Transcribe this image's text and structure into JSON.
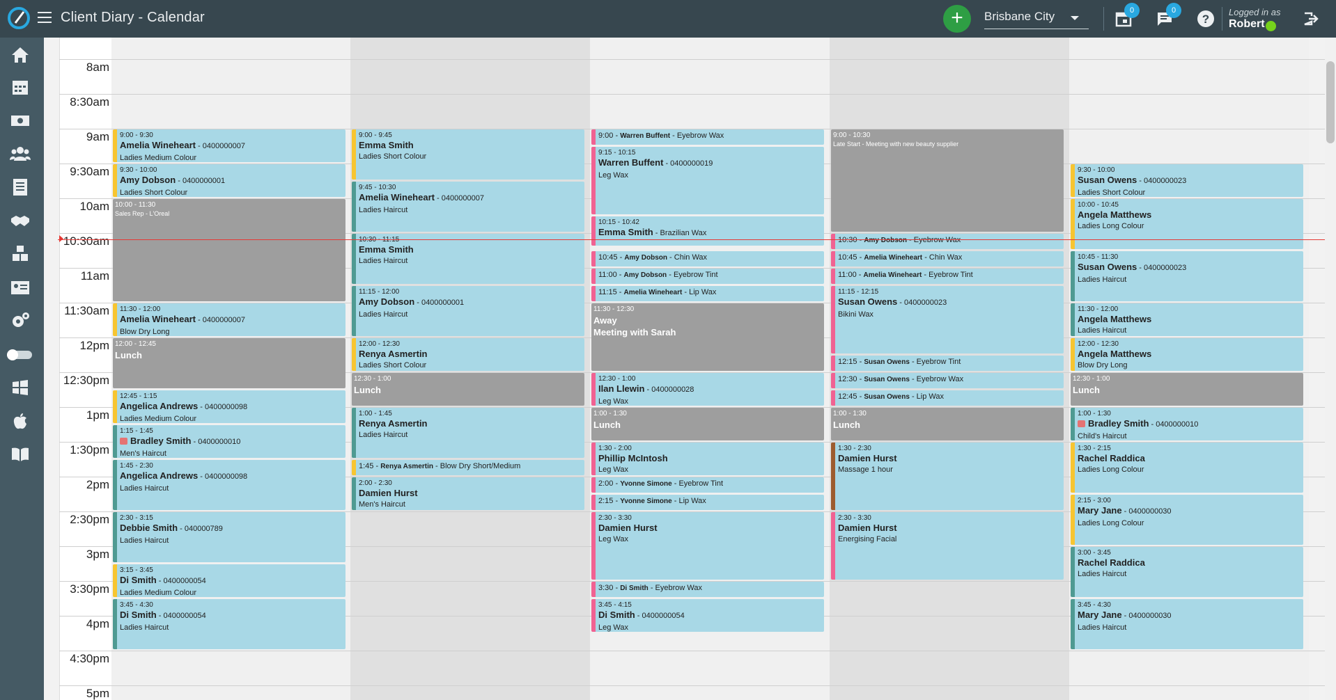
{
  "header": {
    "title": "Client Diary - Calendar",
    "location": "Brisbane City",
    "appointments_badge": "0",
    "messages_badge": "0",
    "logged_in_label": "Logged in as",
    "user": "Robert"
  },
  "sidebar": {
    "items": [
      "home-icon",
      "calendar-icon",
      "cash-icon",
      "clients-icon",
      "notes-icon",
      "handshake-icon",
      "boxes-icon",
      "id-card-icon",
      "settings-icon",
      "toggle-icon",
      "windows-icon",
      "apple-icon",
      "book-icon"
    ]
  },
  "times": [
    "8am",
    "8:30am",
    "9am",
    "9:30am",
    "10am",
    "10:30am",
    "11am",
    "11:30am",
    "12pm",
    "12:30pm",
    "1pm",
    "1:30pm",
    "2pm",
    "2:30pm",
    "3pm",
    "3:30pm",
    "4pm",
    "4:30pm",
    "5pm"
  ],
  "columns": [
    {
      "appointments": [
        {
          "time": "9:00 - 9:30",
          "name": "Amelia Wineheart",
          "phone": " - 0400000007",
          "service": "Ladies Medium Colour",
          "color": "yellow",
          "start": 9.0,
          "end": 9.5
        },
        {
          "time": "9:30 - 10:00",
          "name": "Amy Dobson",
          "phone": " - 0400000001",
          "service": "Ladies Short Colour",
          "color": "yellow",
          "start": 9.5,
          "end": 10.0
        },
        {
          "type": "block",
          "time": "10:00 - 11:30",
          "label": "",
          "sub": "Sales Rep - L'Oreal",
          "start": 10.0,
          "end": 11.5
        },
        {
          "time": "11:30 - 12:00",
          "name": "Amelia Wineheart",
          "phone": " - 0400000007",
          "service": "Blow Dry Long",
          "color": "yellow",
          "start": 11.5,
          "end": 12.0
        },
        {
          "type": "block",
          "time": "12:00 - 12:45",
          "label": "Lunch",
          "sub": "",
          "start": 12.0,
          "end": 12.75
        },
        {
          "time": "12:45 - 1:15",
          "name": "Angelica Andrews",
          "phone": " - 0400000098",
          "service": "Ladies Medium Colour",
          "color": "yellow",
          "start": 12.75,
          "end": 13.25
        },
        {
          "time": "1:15 - 1:45",
          "name": "Bradley Smith",
          "phone": " - 0400000010",
          "service": "Men's Haircut",
          "color": "teal",
          "kid": true,
          "start": 13.25,
          "end": 13.75
        },
        {
          "time": "1:45 - 2:30",
          "name": "Angelica Andrews",
          "phone": " - 0400000098",
          "service": "Ladies Haircut",
          "color": "teal",
          "start": 13.75,
          "end": 14.5
        },
        {
          "time": "2:30 - 3:15",
          "name": "Debbie Smith",
          "phone": " - 040000789",
          "service": "Ladies Haircut",
          "color": "teal",
          "start": 14.5,
          "end": 15.25
        },
        {
          "time": "3:15 - 3:45",
          "name": "Di Smith",
          "phone": " - 0400000054",
          "service": "Ladies Medium Colour",
          "color": "yellow",
          "start": 15.25,
          "end": 15.75
        },
        {
          "time": "3:45 - 4:30",
          "name": "Di Smith",
          "phone": " - 0400000054",
          "service": "Ladies Haircut",
          "color": "teal",
          "start": 15.75,
          "end": 16.5
        }
      ]
    },
    {
      "appointments": [
        {
          "time": "9:00 - 9:45",
          "name": "Emma Smith",
          "phone": "",
          "service": "Ladies Short Colour",
          "color": "yellow",
          "start": 9.0,
          "end": 9.75
        },
        {
          "time": "9:45 - 10:30",
          "name": "Amelia Wineheart",
          "phone": " - 0400000007",
          "service": "Ladies Haircut",
          "color": "teal",
          "start": 9.75,
          "end": 10.5
        },
        {
          "time": "10:30 - 11:15",
          "name": "Emma Smith",
          "phone": "",
          "service": "Ladies Haircut",
          "color": "teal",
          "start": 10.5,
          "end": 11.25
        },
        {
          "time": "11:15 - 12:00",
          "name": "Amy Dobson",
          "phone": " - 0400000001",
          "service": "Ladies Haircut",
          "color": "teal",
          "start": 11.25,
          "end": 12.0
        },
        {
          "time": "12:00 - 12:30",
          "name": "Renya Asmertin",
          "phone": "",
          "service": "Ladies Short Colour",
          "color": "yellow",
          "start": 12.0,
          "end": 12.5
        },
        {
          "type": "block",
          "time": "12:30 - 1:00",
          "label": "Lunch",
          "sub": "",
          "start": 12.5,
          "end": 13.0
        },
        {
          "time": "1:00 - 1:45",
          "name": "Renya Asmertin",
          "phone": "",
          "service": "Ladies Haircut",
          "color": "teal",
          "start": 13.0,
          "end": 13.75
        },
        {
          "type": "line",
          "time": "1:45",
          "name": "Renya Asmertin",
          "service": "Blow Dry Short/Medium",
          "color": "yellow",
          "start": 13.75,
          "end": 14.0
        },
        {
          "time": "2:00 - 2:30",
          "name": "Damien Hurst",
          "phone": "",
          "service": "Men's Haircut",
          "color": "teal",
          "start": 14.0,
          "end": 14.5
        }
      ]
    },
    {
      "appointments": [
        {
          "type": "line",
          "time": "9:00",
          "name": "Warren Buffent",
          "service": "Eyebrow Wax",
          "color": "pink",
          "start": 9.0,
          "end": 9.25
        },
        {
          "time": "9:15 - 10:15",
          "name": "Warren Buffent",
          "phone": " - 0400000019",
          "service": "Leg Wax",
          "color": "pink",
          "start": 9.25,
          "end": 10.25
        },
        {
          "time": "10:15 - 10:42",
          "name": "Emma Smith",
          "phone": "",
          "service": " - Brazilian Wax",
          "inline": true,
          "color": "pink",
          "start": 10.25,
          "end": 10.7
        },
        {
          "type": "line",
          "time": "10:45",
          "name": "Amy Dobson",
          "service": "Chin Wax",
          "color": "pink",
          "start": 10.75,
          "end": 11.0
        },
        {
          "type": "line",
          "time": "11:00",
          "name": "Amy Dobson",
          "service": "Eyebrow Tint",
          "color": "pink",
          "start": 11.0,
          "end": 11.25
        },
        {
          "type": "line",
          "time": "11:15",
          "name": "Amelia Wineheart",
          "service": "Lip Wax",
          "color": "pink",
          "start": 11.25,
          "end": 11.5
        },
        {
          "type": "block",
          "time": "11:30 - 12:30",
          "label": "Away",
          "sub2": "Meeting with Sarah",
          "start": 11.5,
          "end": 12.5
        },
        {
          "time": "12:30 - 1:00",
          "name": "Ilan Llewin",
          "phone": " - 0400000028",
          "service": "Leg Wax",
          "color": "pink",
          "start": 12.5,
          "end": 13.0
        },
        {
          "type": "block",
          "time": "1:00 - 1:30",
          "label": "Lunch",
          "sub": "",
          "start": 13.0,
          "end": 13.5
        },
        {
          "time": "1:30 - 2:00",
          "name": "Phillip McIntosh",
          "phone": "",
          "service": "Leg Wax",
          "color": "pink",
          "start": 13.5,
          "end": 14.0
        },
        {
          "type": "line",
          "time": "2:00",
          "name": "Yvonne Simone",
          "service": "Eyebrow Tint",
          "color": "pink",
          "start": 14.0,
          "end": 14.25
        },
        {
          "type": "line",
          "time": "2:15",
          "name": "Yvonne Simone",
          "service": "Lip Wax",
          "color": "pink",
          "start": 14.25,
          "end": 14.5
        },
        {
          "time": "2:30 - 3:30",
          "name": "Damien Hurst",
          "phone": "",
          "service": "Leg Wax",
          "color": "pink",
          "start": 14.5,
          "end": 15.5
        },
        {
          "type": "line",
          "time": "3:30",
          "name": "Di Smith",
          "service": "Eyebrow Wax",
          "color": "pink",
          "start": 15.5,
          "end": 15.75
        },
        {
          "time": "3:45 - 4:15",
          "name": "Di Smith",
          "phone": " - 0400000054",
          "service": "Leg Wax",
          "color": "pink",
          "start": 15.75,
          "end": 16.25
        }
      ]
    },
    {
      "appointments": [
        {
          "type": "block",
          "time": "9:00 - 10:30",
          "label": "",
          "sub": "Late Start - Meeting with new beauty supplier",
          "start": 9.0,
          "end": 10.5
        },
        {
          "type": "line",
          "time": "10:30",
          "name": "Amy Dobson",
          "service": "Eyebrow Wax",
          "color": "pink",
          "start": 10.5,
          "end": 10.75
        },
        {
          "type": "line",
          "time": "10:45",
          "name": "Amelia Wineheart",
          "service": "Chin Wax",
          "color": "pink",
          "start": 10.75,
          "end": 11.0
        },
        {
          "type": "line",
          "time": "11:00",
          "name": "Amelia Wineheart",
          "service": "Eyebrow Tint",
          "color": "pink",
          "start": 11.0,
          "end": 11.25
        },
        {
          "time": "11:15 - 12:15",
          "name": "Susan Owens",
          "phone": " - 0400000023",
          "service": "Bikini Wax",
          "color": "pink",
          "start": 11.25,
          "end": 12.25
        },
        {
          "type": "line",
          "time": "12:15",
          "name": "Susan Owens",
          "service": "Eyebrow Tint",
          "color": "pink",
          "start": 12.25,
          "end": 12.5
        },
        {
          "type": "line",
          "time": "12:30",
          "name": "Susan Owens",
          "service": "Eyebrow Wax",
          "color": "pink",
          "start": 12.5,
          "end": 12.75
        },
        {
          "type": "line",
          "time": "12:45",
          "name": "Susan Owens",
          "service": "Lip Wax",
          "color": "pink",
          "start": 12.75,
          "end": 13.0
        },
        {
          "type": "block",
          "time": "1:00 - 1:30",
          "label": "Lunch",
          "sub": "",
          "start": 13.0,
          "end": 13.5
        },
        {
          "time": "1:30 - 2:30",
          "name": "Damien Hurst",
          "phone": "",
          "service": "Massage 1 hour",
          "color": "brown",
          "start": 13.5,
          "end": 14.5
        },
        {
          "time": "2:30 - 3:30",
          "name": "Damien Hurst",
          "phone": "",
          "service": "Energising Facial",
          "color": "pink",
          "start": 14.5,
          "end": 15.5
        }
      ]
    },
    {
      "appointments": [
        {
          "time": "9:30 - 10:00",
          "name": "Susan Owens",
          "phone": " - 0400000023",
          "service": "Ladies Short Colour",
          "color": "yellow",
          "start": 9.5,
          "end": 10.0
        },
        {
          "time": "10:00 - 10:45",
          "name": "Angela Matthews",
          "phone": "",
          "service": "Ladies Long Colour",
          "color": "yellow",
          "start": 10.0,
          "end": 10.75
        },
        {
          "time": "10:45 - 11:30",
          "name": "Susan Owens",
          "phone": " - 0400000023",
          "service": "Ladies Haircut",
          "color": "teal",
          "start": 10.75,
          "end": 11.5
        },
        {
          "time": "11:30 - 12:00",
          "name": "Angela Matthews",
          "phone": "",
          "service": "Ladies Haircut",
          "color": "teal",
          "start": 11.5,
          "end": 12.0
        },
        {
          "time": "12:00 - 12:30",
          "name": "Angela Matthews",
          "phone": "",
          "service": "Blow Dry Long",
          "color": "yellow",
          "start": 12.0,
          "end": 12.5
        },
        {
          "type": "block",
          "time": "12:30 - 1:00",
          "label": "Lunch",
          "sub": "",
          "start": 12.5,
          "end": 13.0
        },
        {
          "time": "1:00 - 1:30",
          "name": "Bradley Smith",
          "phone": " - 0400000010",
          "service": "Child's Haircut",
          "color": "teal",
          "kid": true,
          "start": 13.0,
          "end": 13.5
        },
        {
          "time": "1:30 - 2:15",
          "name": "Rachel Raddica",
          "phone": "",
          "service": "Ladies Long Colour",
          "color": "yellow",
          "start": 13.5,
          "end": 14.25
        },
        {
          "time": "2:15 - 3:00",
          "name": "Mary Jane",
          "phone": " - 0400000030",
          "service": "Ladies Long Colour",
          "color": "yellow",
          "start": 14.25,
          "end": 15.0
        },
        {
          "time": "3:00 - 3:45",
          "name": "Rachel Raddica",
          "phone": "",
          "service": "Ladies Haircut",
          "color": "teal",
          "start": 15.0,
          "end": 15.75
        },
        {
          "time": "3:45 - 4:30",
          "name": "Mary Jane",
          "phone": " - 0400000030",
          "service": "Ladies Haircut",
          "color": "teal",
          "start": 15.75,
          "end": 16.5
        }
      ]
    }
  ],
  "colors": {
    "accent_green": "#2e9e44",
    "appointment_bg": "#a8d8e6",
    "block_bg": "#9e9e9e",
    "now_line": "#e53935"
  }
}
